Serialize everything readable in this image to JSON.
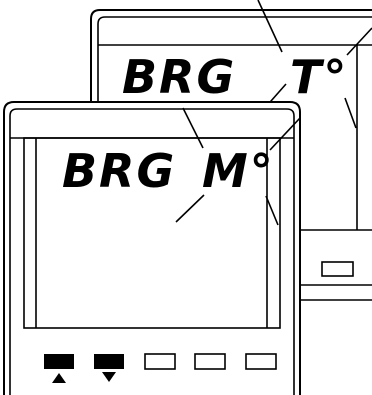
{
  "back_display": {
    "left_text": "BRG",
    "right_text": "T°"
  },
  "front_display": {
    "left_text": "BRG",
    "right_text": "M°"
  },
  "front_buttons": [
    {
      "name": "up-arrow-button",
      "icon": "triangle-up",
      "filled": true
    },
    {
      "name": "down-arrow-button",
      "icon": "triangle-down",
      "filled": true
    },
    {
      "name": "button-3",
      "icon": "blank",
      "filled": false
    },
    {
      "name": "button-4",
      "icon": "blank",
      "filled": false
    },
    {
      "name": "button-5",
      "icon": "blank",
      "filled": false
    }
  ],
  "colors": {
    "ink": "#000000",
    "paper": "#ffffff"
  }
}
